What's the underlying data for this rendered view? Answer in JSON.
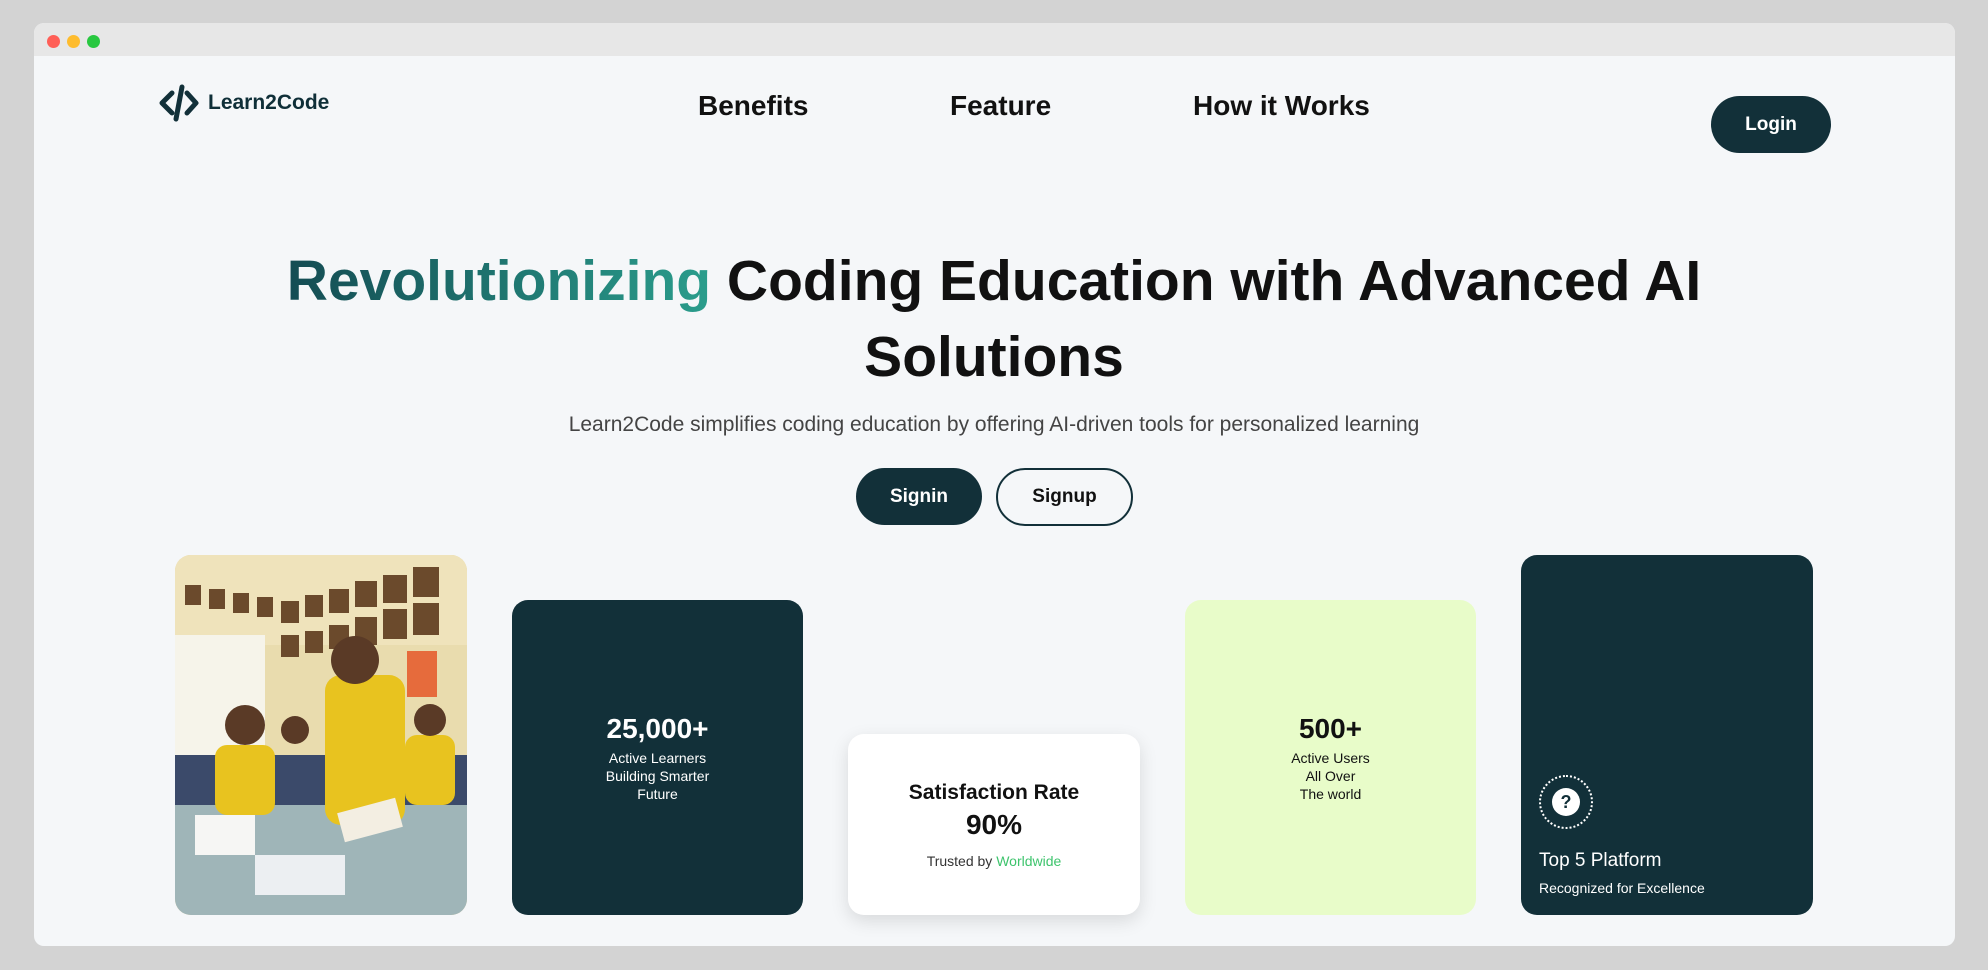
{
  "brand": {
    "name": "Learn2Code"
  },
  "nav": {
    "links": [
      "Benefits",
      "Feature",
      "How it Works"
    ],
    "login_label": "Login"
  },
  "hero": {
    "title_accent": "Revolutionizing",
    "title_rest": " Coding Education with Advanced AI Solutions",
    "subtitle": "Learn2Code simplifies coding education by offering AI-driven tools for personalized learning",
    "signin_label": "Signin",
    "signup_label": "Signup"
  },
  "stats": {
    "learners": {
      "value": "25,000+",
      "lines": [
        "Active Learners",
        "Building Smarter",
        "Future"
      ]
    },
    "satisfaction": {
      "title": "Satisfaction Rate",
      "value": "90%",
      "trusted_prefix": "Trusted by ",
      "trusted_highlight": "Worldwide"
    },
    "users": {
      "value": "500+",
      "lines": [
        "Active Users",
        "All Over",
        "The world"
      ]
    },
    "platform": {
      "title": "Top 5 Platform",
      "subtitle": "Recognized for Excellence",
      "icon": "question-icon"
    }
  },
  "colors": {
    "primary_dark": "#123039",
    "accent_green": "#3ec46d",
    "light_green_card": "#e8fcc9",
    "page_bg": "#f5f7f9"
  }
}
